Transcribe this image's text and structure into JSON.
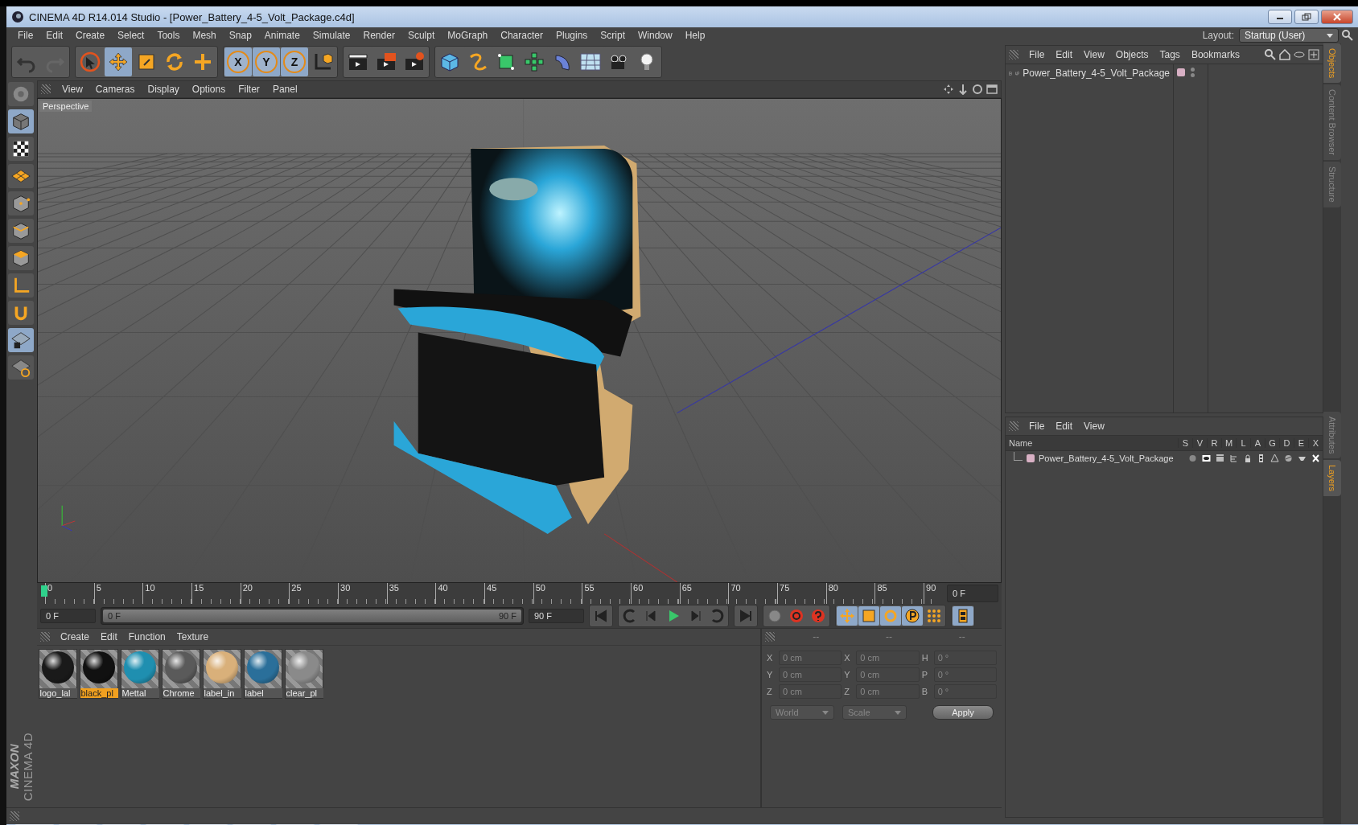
{
  "window": {
    "title": "CINEMA 4D R14.014 Studio - [Power_Battery_4-5_Volt_Package.c4d]"
  },
  "menu": [
    "File",
    "Edit",
    "Create",
    "Select",
    "Tools",
    "Mesh",
    "Snap",
    "Animate",
    "Simulate",
    "Render",
    "Sculpt",
    "MoGraph",
    "Character",
    "Plugins",
    "Script",
    "Window",
    "Help"
  ],
  "layout": {
    "label": "Layout:",
    "value": "Startup (User)"
  },
  "toolbar": [
    [
      {
        "selected": false
      },
      {
        "selected": false
      }
    ],
    [
      {
        "selected": false
      },
      {
        "selected": true
      },
      {
        "selected": false
      },
      {
        "selected": false
      },
      {
        "selected": false
      }
    ],
    [
      {
        "label": "X",
        "selected": true
      },
      {
        "label": "Y",
        "selected": true
      },
      {
        "label": "Z",
        "selected": true
      },
      {
        "selected": false
      }
    ],
    [
      {
        "selected": false
      },
      {
        "selected": false
      },
      {
        "selected": false
      }
    ],
    [
      {
        "selected": false
      },
      {
        "selected": false
      },
      {
        "selected": false
      },
      {
        "selected": false
      },
      {
        "selected": false
      },
      {
        "selected": false
      },
      {
        "selected": false
      },
      {
        "selected": false
      }
    ]
  ],
  "left_tools": [
    {
      "selected": false
    },
    {
      "selected": true
    },
    {
      "selected": false
    },
    {
      "selected": false
    },
    {
      "selected": false
    },
    {
      "selected": false
    },
    {
      "selected": false
    },
    {
      "selected": false
    },
    {
      "selected": false
    },
    {
      "selected": true
    },
    {
      "selected": false
    }
  ],
  "viewport": {
    "menu": [
      "View",
      "Cameras",
      "Display",
      "Options",
      "Filter",
      "Panel"
    ],
    "label": "Perspective"
  },
  "timeline": {
    "ruler": [
      "0",
      "5",
      "10",
      "15",
      "20",
      "25",
      "30",
      "35",
      "40",
      "45",
      "50",
      "55",
      "60",
      "65",
      "70",
      "75",
      "80",
      "85",
      "90"
    ],
    "current_frame": "0 F",
    "start": "0 F",
    "range": {
      "start": "0 F",
      "end": "90 F",
      "level": 1
    },
    "end": "90 F"
  },
  "playback_tools": [
    {
      "selected": false
    },
    {
      "selected": false
    },
    {
      "selected": false
    },
    {
      "selected": false
    },
    {
      "selected": false
    },
    {
      "selected": false
    },
    {
      "selected": false
    },
    {
      "selected": false
    },
    {
      "selected": false
    },
    {
      "selected": false
    },
    {
      "selected": true
    },
    {
      "selected": true
    },
    {
      "selected": true
    },
    {
      "selected": true
    },
    {
      "selected": false
    },
    {
      "selected": true
    }
  ],
  "materials": {
    "menu": [
      "Create",
      "Edit",
      "Function",
      "Texture"
    ],
    "items": [
      {
        "name": "logo_lal",
        "selected": false,
        "color": "#1a1a1a"
      },
      {
        "name": "black_pl",
        "selected": true,
        "color": "#111111"
      },
      {
        "name": "Mettal",
        "selected": false,
        "color": "#1f8fb0"
      },
      {
        "name": "Chrome",
        "selected": false,
        "color": "#5a5a5a"
      },
      {
        "name": "label_in",
        "selected": false,
        "color": "#d9b07a"
      },
      {
        "name": "label",
        "selected": false,
        "color": "#2a6f9a"
      },
      {
        "name": "clear_pl",
        "selected": false,
        "color": "#8a8a8a"
      }
    ]
  },
  "coordinates": {
    "headers": [
      "--",
      "--",
      "--"
    ],
    "rows": [
      {
        "position_axis": "X",
        "position": "0 cm",
        "size_axis": "X",
        "size": "0 cm",
        "rotation_axis": "H",
        "rotation": "0 °"
      },
      {
        "position_axis": "Y",
        "position": "0 cm",
        "size_axis": "Y",
        "size": "0 cm",
        "rotation_axis": "P",
        "rotation": "0 °"
      },
      {
        "position_axis": "Z",
        "position": "0 cm",
        "size_axis": "Z",
        "size": "0 cm",
        "rotation_axis": "B",
        "rotation": "0 °"
      }
    ],
    "space": "World",
    "mode": "Scale",
    "apply": "Apply"
  },
  "objects": {
    "menu": [
      "File",
      "Edit",
      "View",
      "Objects",
      "Tags",
      "Bookmarks"
    ],
    "items": [
      {
        "name": "Power_Battery_4-5_Volt_Package",
        "color": "#d8b0c4"
      }
    ]
  },
  "layers": {
    "menu": [
      "File",
      "Edit",
      "View"
    ],
    "columns": [
      "Name",
      "S",
      "V",
      "R",
      "M",
      "L",
      "A",
      "G",
      "D",
      "E",
      "X"
    ],
    "items": [
      {
        "name": "Power_Battery_4-5_Volt_Package",
        "color": "#d8b0c4"
      }
    ]
  },
  "side_tabs": [
    {
      "label": "Objects",
      "selected": true
    },
    {
      "label": "Content Browser",
      "selected": false
    },
    {
      "label": "Structure",
      "selected": false
    },
    {
      "label": "Attributes",
      "selected": false
    },
    {
      "label": "Layers",
      "selected": true
    }
  ],
  "logo": {
    "brand": "MAXON",
    "product": "CINEMA 4D"
  }
}
